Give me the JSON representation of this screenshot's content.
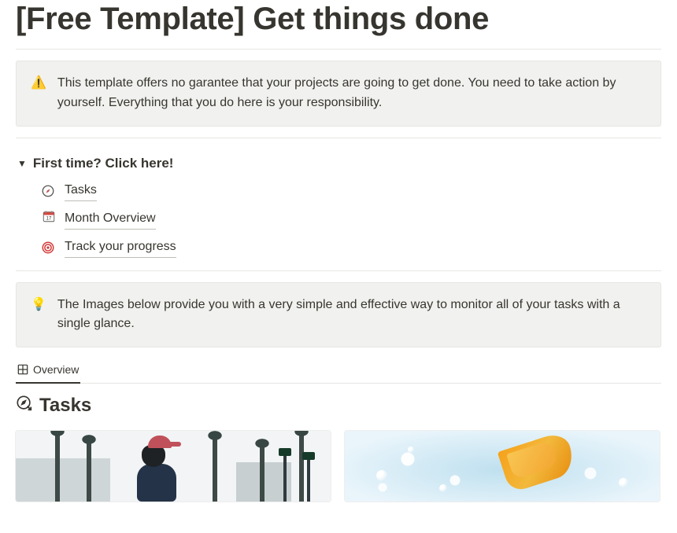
{
  "page": {
    "title": "[Free Template] Get things done"
  },
  "callouts": {
    "warning": {
      "icon": "⚠️",
      "text": "This template offers no garantee that your projects are going to get done. You need to take action by yourself. Everything that you do here is your responsibility."
    },
    "tip": {
      "icon": "💡",
      "text": "The Images below provide you with a very simple and effective way to monitor all of your tasks with a single glance."
    }
  },
  "toggle": {
    "title": "First time? Click here!",
    "items": [
      {
        "icon": "compass",
        "label": "Tasks"
      },
      {
        "icon": "calendar",
        "label": "Month Overview"
      },
      {
        "icon": "target",
        "label": "Track your progress"
      }
    ]
  },
  "tabs": {
    "overview": "Overview"
  },
  "sections": {
    "tasks": {
      "icon": "compass-arrow",
      "title": "Tasks"
    }
  }
}
